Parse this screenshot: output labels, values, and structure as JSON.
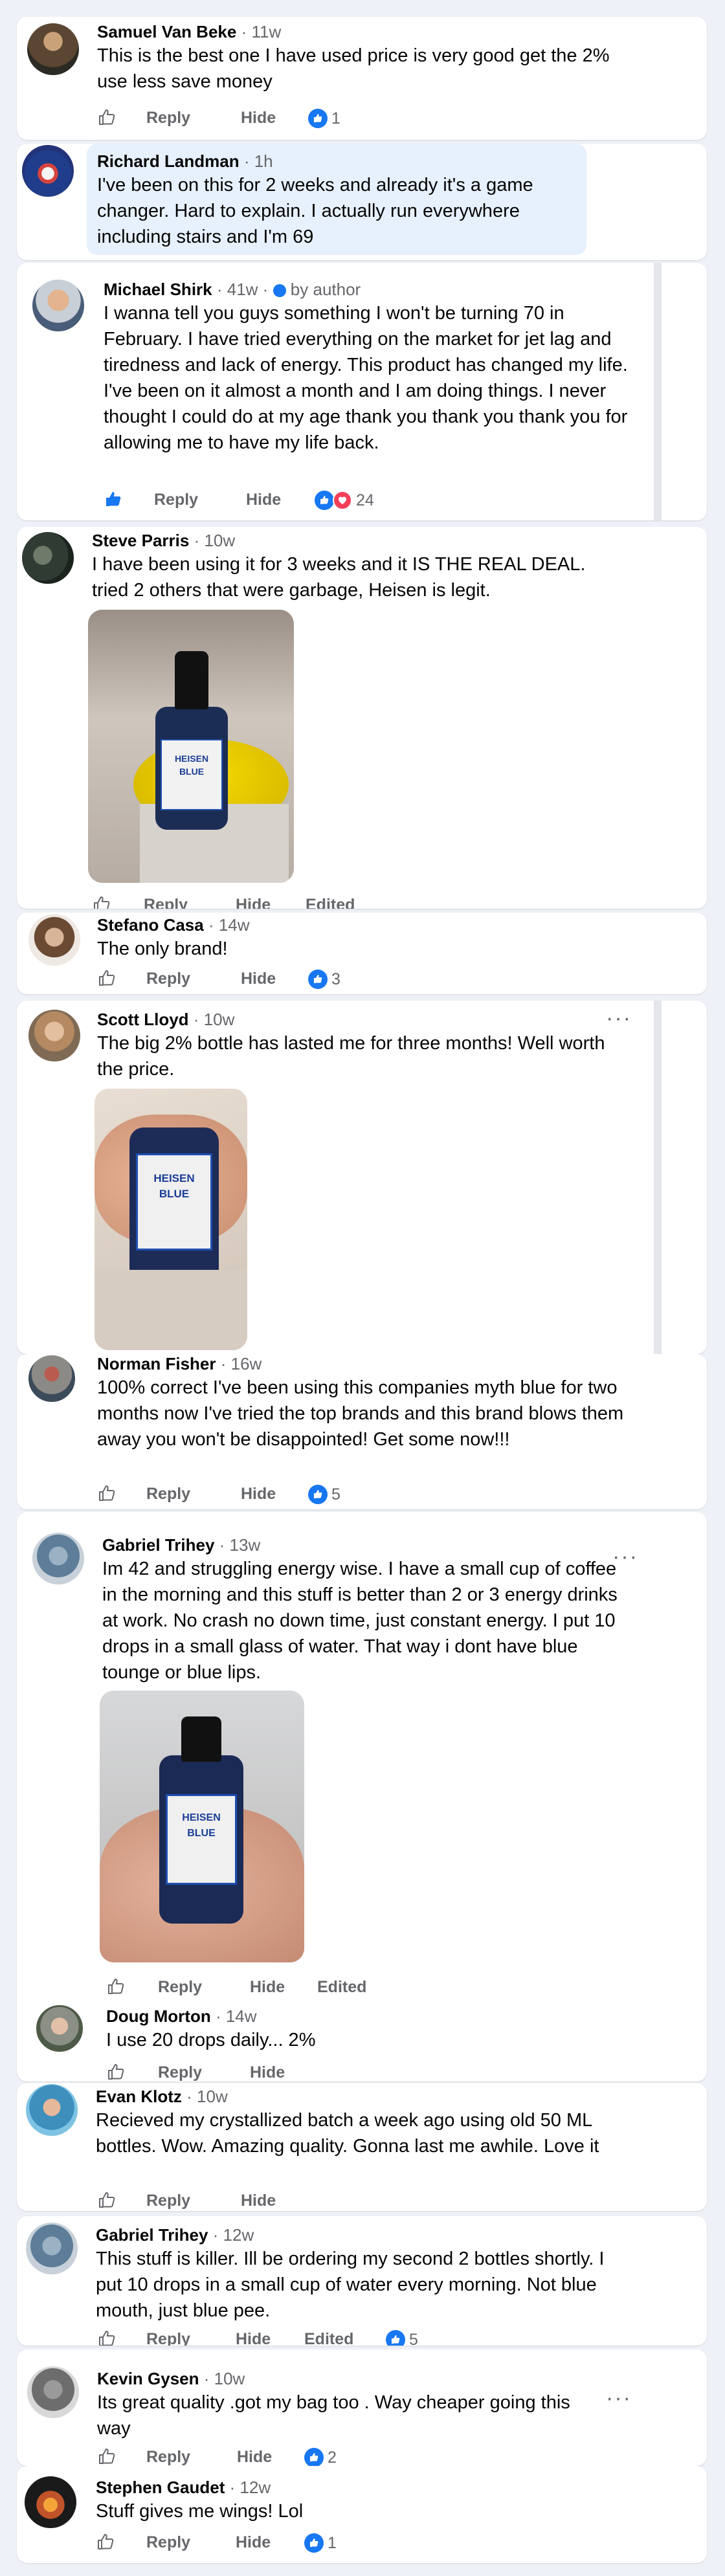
{
  "colors": {
    "accent": "#1877f2",
    "page_bg": "#eef1f7",
    "bubble": "#e7f0fd"
  },
  "actions": {
    "reply": "Reply",
    "hide": "Hide",
    "edited": "Edited"
  },
  "comments": [
    {
      "name": "Samuel Van Beke",
      "time": "· 11w",
      "text": "This is the best one I have used price is very good get the 2% use less save money",
      "reactions": "1"
    },
    {
      "name": "Richard Landman",
      "time": "· 1h",
      "text": "I've been on this for 2 weeks and already it's a game changer. Hard to explain. I actually run everywhere including stairs and I'm 69"
    },
    {
      "name": "Michael Shirk",
      "time": "· 41w ·",
      "author_badge": "by author",
      "text": "I wanna tell you guys something I won't be turning 70 in February. I have tried everything on the market for jet lag and tiredness and lack of energy. This product has changed my life. I've been on it almost a month and I am doing  things. I never thought I could do at my age thank you thank you thank you for allowing me to have my life back.",
      "reactions": "24"
    },
    {
      "name": "Steve Parris",
      "time": "· 10w",
      "text": "I have been using it for 3 weeks and it IS THE REAL DEAL. tried 2 others that were garbage, Heisen is legit.",
      "photo_label": "HEISEN BLUE"
    },
    {
      "name": "Stefano Casa",
      "time": "· 14w",
      "text": "The only brand!",
      "reactions": "3"
    },
    {
      "name": "Scott Lloyd",
      "time": "· 10w",
      "text": "The big 2% bottle has lasted me for three months! Well worth the price.",
      "photo_label": "HEISEN BLUE"
    },
    {
      "name": "Norman Fisher",
      "time": "· 16w",
      "text": "100% correct I've been using this companies myth blue for two months now I've tried the top brands and this brand blows them away you won't be disappointed! Get some now!!!",
      "reactions": "5"
    },
    {
      "name": "Gabriel Trihey",
      "time": "· 13w",
      "text": "Im 42 and struggling energy wise. I have a small cup of coffee in the morning and this stuff is better than 2 or 3 energy drinks at work. No crash no down time, just constant energy. I put 10 drops in a small glass of water. That way i dont have blue tounge or blue lips.",
      "photo_label": "HEISEN BLUE"
    },
    {
      "name": "Doug Morton",
      "time": "· 14w",
      "text": "I use 20 drops daily... 2%"
    },
    {
      "name": "Evan Klotz",
      "time": "· 10w",
      "text": "Recieved my crystallized batch a week ago using old 50 ML bottles. Wow. Amazing quality. Gonna last me awhile. Love it"
    },
    {
      "name": "Gabriel Trihey",
      "time": "· 12w",
      "text": "This stuff is killer. Ill be ordering my second 2 bottles shortly. I put 10 drops in a small cup of water every morning. Not blue mouth, just blue pee.",
      "reactions": "5"
    },
    {
      "name": "Kevin Gysen",
      "time": "· 10w",
      "text": "Its great quality .got my bag too . Way cheaper going this way",
      "reactions": "2"
    },
    {
      "name": "Stephen Gaudet",
      "time": "· 12w",
      "text": "Stuff gives me wings! Lol",
      "reactions": "1"
    }
  ]
}
